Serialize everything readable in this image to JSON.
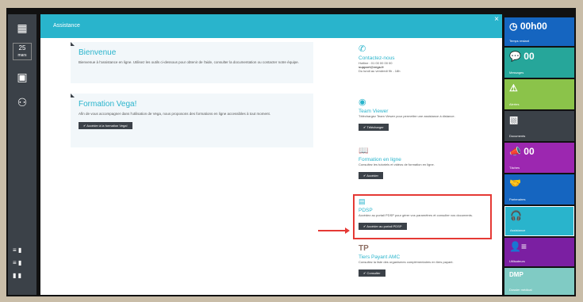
{
  "sidebar": {
    "date_number": "25",
    "date_label": "mars"
  },
  "modal": {
    "header_title": "Assistance",
    "close": "×"
  },
  "left_cards": [
    {
      "title": "Bienvenue",
      "text": "Bienvenue à l'assistance en ligne. Utilisez les outils ci-dessous pour obtenir de l'aide, consulter la documentation ou contacter notre équipe."
    },
    {
      "title": "Formation Vega!",
      "text": "Afin de vous accompagner dans l'utilisation de Vega, nous proposons des formations en ligne accessibles à tout moment.",
      "button": "Accéder à la formation Vega!"
    }
  ],
  "right_items": [
    {
      "title": "Contactez-nous",
      "text": "Hotline : 01 00 00 00 00",
      "email": "support@vega.fr",
      "hours": "Du lundi au vendredi 9h - 18h"
    },
    {
      "title": "Team Viewer",
      "text": "Téléchargez Team Viewer pour permettre une assistance à distance.",
      "button": "Télécharger"
    },
    {
      "title": "Formation en ligne",
      "text": "Consultez les tutoriels et vidéos de formation en ligne.",
      "button": "Accéder"
    },
    {
      "title": "PDSP",
      "text": "Accédez au portail PDSP pour gérer vos paramètres et consulter vos documents.",
      "button": "Accéder au portail PDSP"
    },
    {
      "title": "Tiers Payant AMC",
      "text": "Consultez la liste des organismes complémentaires en tiers payant.",
      "button": "Consulter",
      "logo": "TP"
    }
  ],
  "tiles": [
    {
      "value": "00h00",
      "label": "Temps restant",
      "color": "#1565c0"
    },
    {
      "value": "00",
      "label": "Messages",
      "color": "#26a69a"
    },
    {
      "value": "",
      "label": "Alertes",
      "color": "#8bc34a"
    },
    {
      "value": "",
      "label": "Documents",
      "color": "#3b4148"
    },
    {
      "value": "00",
      "label": "Tâches",
      "color": "#9c27b0"
    },
    {
      "value": "",
      "label": "Partenaires",
      "color": "#1565c0"
    },
    {
      "value": "",
      "label": "Assistance",
      "color": "#29b4cc"
    },
    {
      "value": "",
      "label": "Utilisateurs",
      "color": "#7b1fa2"
    },
    {
      "value": "DMP",
      "label": "Dossier médical",
      "color": "#80cbc4"
    }
  ]
}
